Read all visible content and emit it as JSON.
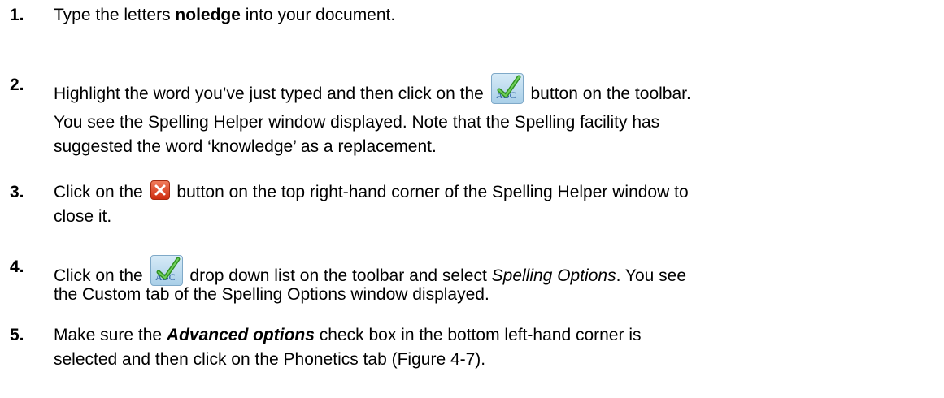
{
  "steps": [
    {
      "number": "1.",
      "text_before": "Type the letters ",
      "bold_word": "noledge",
      "text_after": " into your document."
    },
    {
      "number": "2.",
      "text_before": "Highlight the word you’ve just typed and then click on the ",
      "icon": "abc-spellcheck-icon",
      "text_after": " button on the toolbar.",
      "para_line1": "You see the Spelling Helper window displayed. Note that the Spelling facility has",
      "para_line2": "suggested the word ‘knowledge’ as a replacement."
    },
    {
      "number": "3.",
      "text_before": "Click on the ",
      "icon": "close-icon",
      "text_after": " button on the top right-hand corner of the Spelling Helper window to",
      "line2": "close it."
    },
    {
      "number": "4.",
      "text_before": "Click on the ",
      "icon": "abc-spellcheck-icon",
      "text_mid": " drop down list on the toolbar and select ",
      "italic_word": "Spelling Options",
      "text_after": ". You see",
      "line2": "the Custom tab of the Spelling Options window displayed."
    },
    {
      "number": "5.",
      "text_before": "Make sure the ",
      "bold_italic_word": "Advanced options",
      "text_after": " check box in the bottom left-hand corner is",
      "line2": "selected and then click on the Phonetics tab (Figure 4-7)."
    }
  ],
  "colors": {
    "text": "#000000",
    "abc_icon_bg": "#a9cfe8",
    "abc_check": "#3a9a2a",
    "close_icon_bg": "#cf2d10"
  }
}
